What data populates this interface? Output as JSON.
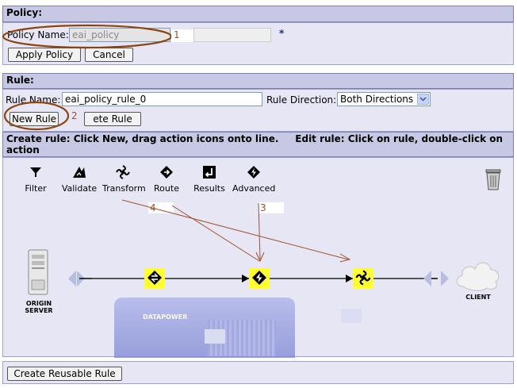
{
  "policy": {
    "header": "Policy:",
    "name_label": "Policy Name:",
    "name_value": "eai_policy",
    "required_mark": "*",
    "apply_button": "Apply Policy",
    "cancel_button": "Cancel",
    "annotation": "1"
  },
  "rule": {
    "header": "Rule:",
    "name_label": "Rule Name:",
    "name_value": "eai_policy_rule_0",
    "direction_label": "Rule Direction:",
    "direction_value": "Both Directions",
    "new_button": "New Rule",
    "delete_button": "ete Rule",
    "annotation": "2"
  },
  "instructions": "Create rule: Click New, drag action icons onto line.     Edit rule: Click on rule, double-click on action",
  "palette": [
    {
      "label": "Filter",
      "icon": "filter-icon"
    },
    {
      "label": "Validate",
      "icon": "validate-icon"
    },
    {
      "label": "Transform",
      "icon": "transform-icon"
    },
    {
      "label": "Route",
      "icon": "route-icon"
    },
    {
      "label": "Results",
      "icon": "results-icon"
    },
    {
      "label": "Advanced",
      "icon": "advanced-icon"
    }
  ],
  "annotations": {
    "advanced": "3",
    "transform": "4"
  },
  "endpoints": {
    "origin": "ORIGIN SERVER",
    "client": "CLIENT"
  },
  "device_brand": "DATAPOWER",
  "footer": {
    "reusable_button": "Create Reusable Rule"
  },
  "colors": {
    "header_bg": "#c7c9e4",
    "panel_bg": "#e6e6f5",
    "annotation": "#a0522d",
    "action_highlight": "#ffff33"
  }
}
